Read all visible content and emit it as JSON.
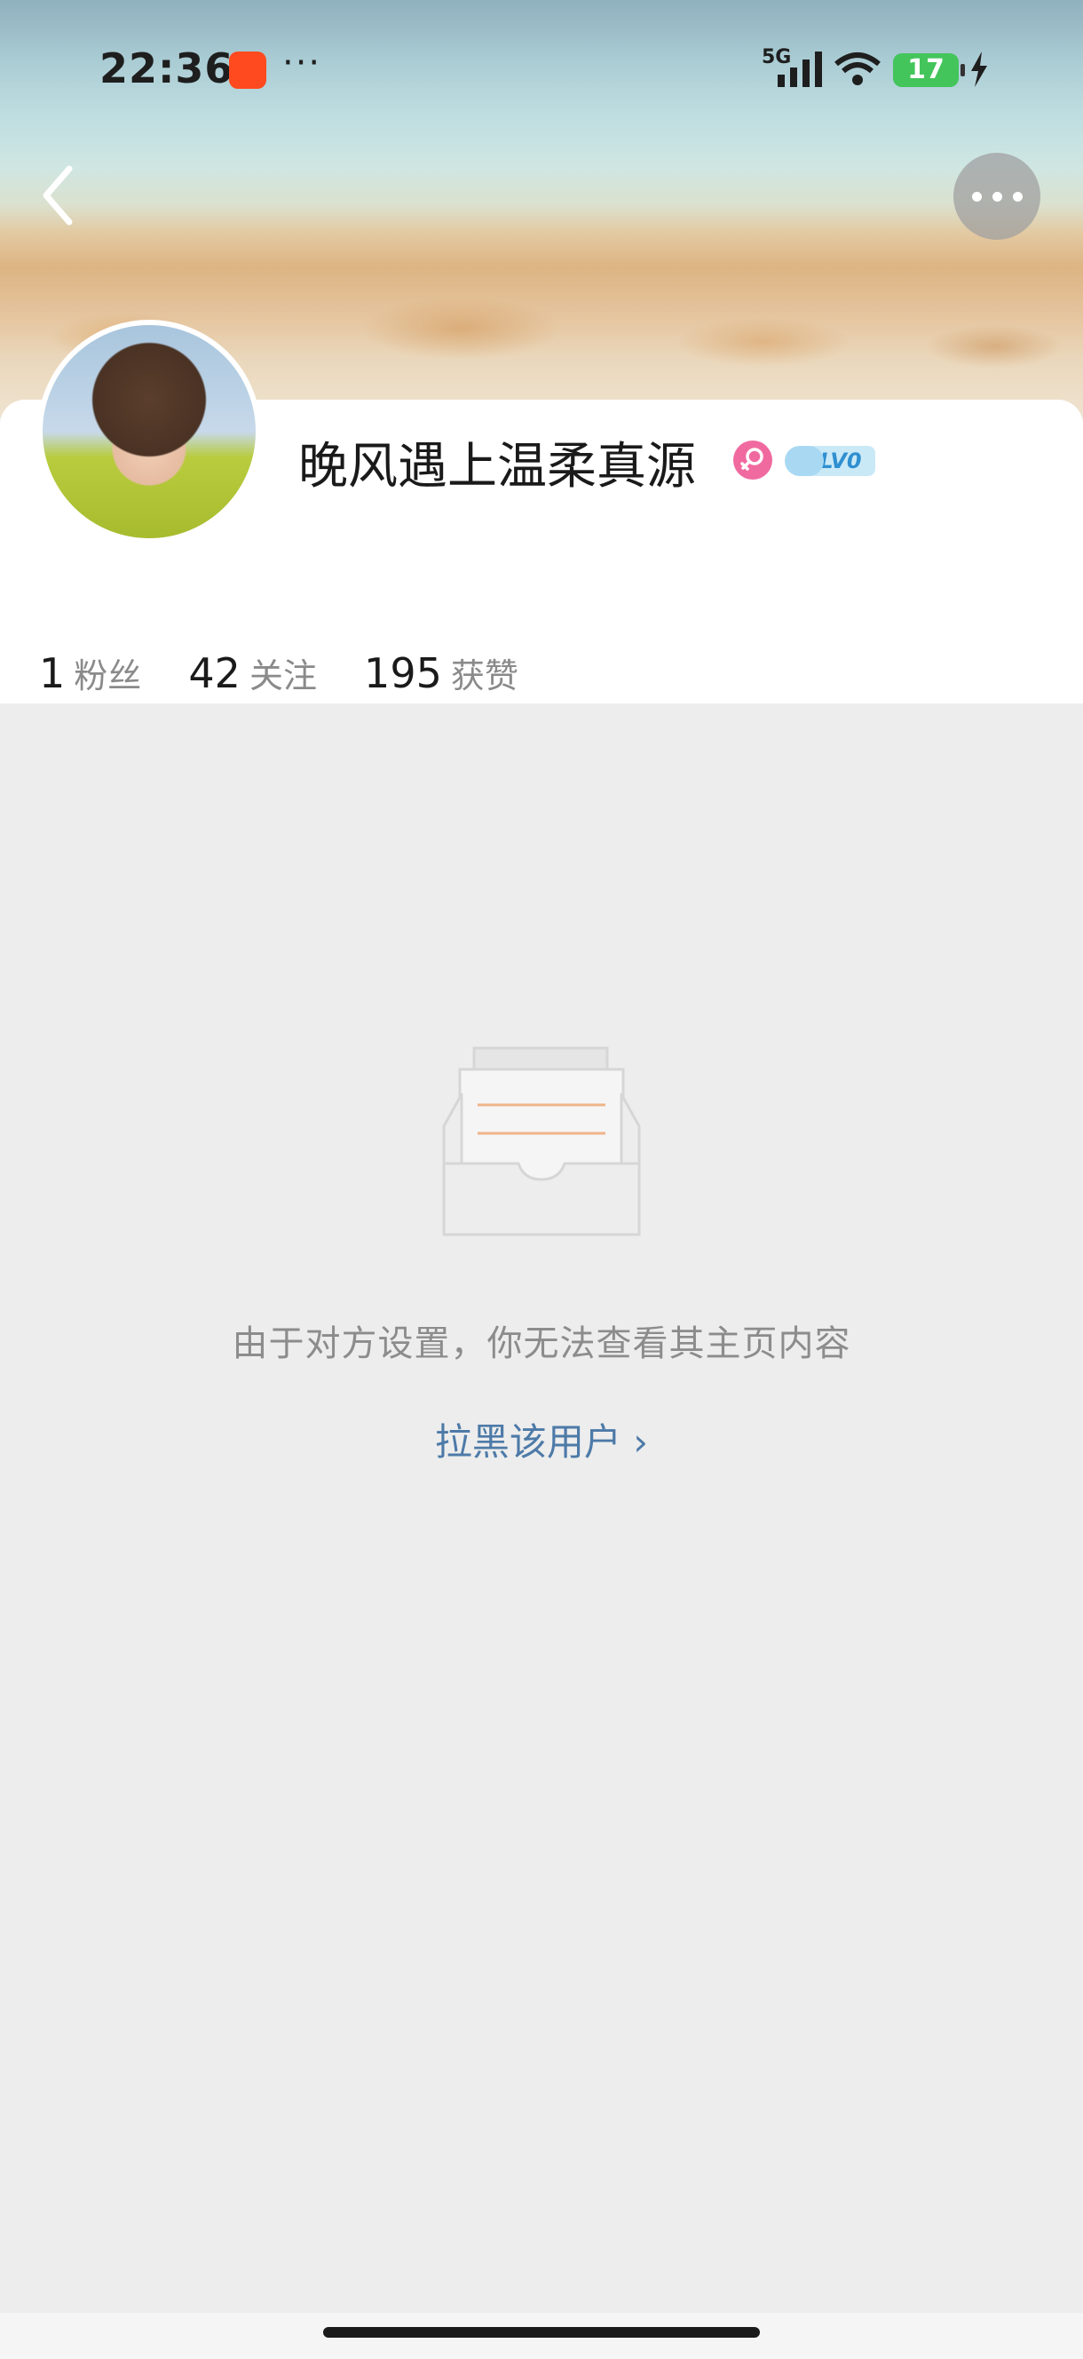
{
  "status_bar": {
    "time": "22:36",
    "network": "5G",
    "battery": "17"
  },
  "profile": {
    "username": "晚风遇上温柔真源",
    "level": "LV0"
  },
  "stats": [
    {
      "value": "1",
      "label": "粉丝"
    },
    {
      "value": "42",
      "label": "关注"
    },
    {
      "value": "195",
      "label": "获赞"
    }
  ],
  "empty_state": {
    "message": "由于对方设置，你无法查看其主页内容",
    "block_link": "拉黑该用户 ›"
  },
  "colors": {
    "accent_link": "#4d7aa8",
    "gender_badge": "#f06aa0",
    "battery": "#43c55b"
  },
  "icons": [
    "back-arrow-icon",
    "more-icon",
    "female-gender-icon",
    "level-cloud-icon",
    "empty-inbox-icon"
  ]
}
